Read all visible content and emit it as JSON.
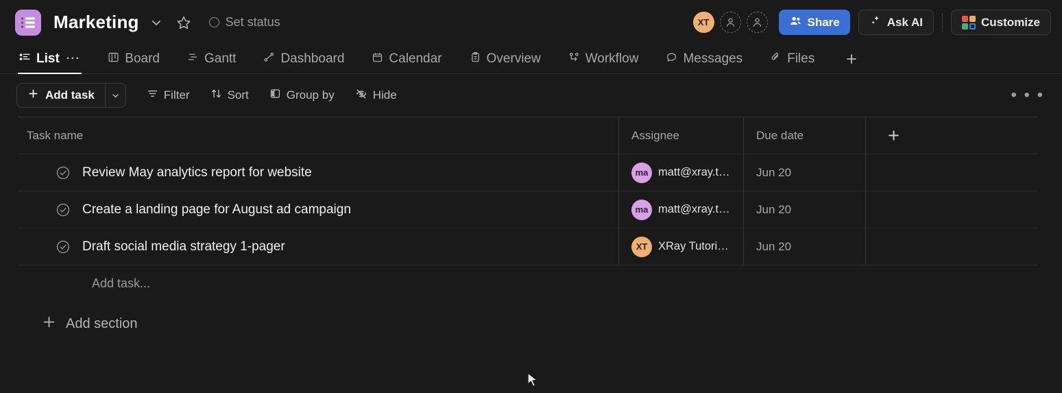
{
  "header": {
    "app_icon": "list-app-icon",
    "title": "Marketing",
    "title_chevron_icon": "chevron-down-icon",
    "favorite_icon": "star-icon",
    "set_status_label": "Set status",
    "status_icon": "circle-icon",
    "avatars": [
      {
        "initials": "XT",
        "color": "#f0b071",
        "name": "xray-tutorials-avatar"
      },
      {
        "initials": "",
        "color": "",
        "name": "invite-member-avatar-1"
      },
      {
        "initials": "",
        "color": "",
        "name": "invite-member-avatar-2"
      }
    ],
    "share_label": "Share",
    "share_icon": "people-icon",
    "share_color": "#3b6fd4",
    "ask_ai_label": "Ask AI",
    "ask_ai_icon": "sparkles-icon",
    "customize_label": "Customize",
    "customize_icon": "color-blocks-icon",
    "customize_colors": [
      "#e8584b",
      "#efae5a",
      "#4aa97a",
      "#3b82e0"
    ]
  },
  "tabs": {
    "items": [
      {
        "label": "List",
        "icon": "list-icon",
        "active": true,
        "has_dots": true
      },
      {
        "label": "Board",
        "icon": "board-icon",
        "active": false,
        "has_dots": false
      },
      {
        "label": "Gantt",
        "icon": "gantt-icon",
        "active": false,
        "has_dots": false
      },
      {
        "label": "Dashboard",
        "icon": "dashboard-icon",
        "active": false,
        "has_dots": false
      },
      {
        "label": "Calendar",
        "icon": "calendar-icon",
        "active": false,
        "has_dots": false
      },
      {
        "label": "Overview",
        "icon": "clipboard-icon",
        "active": false,
        "has_dots": false
      },
      {
        "label": "Workflow",
        "icon": "workflow-icon",
        "active": false,
        "has_dots": false
      },
      {
        "label": "Messages",
        "icon": "chat-icon",
        "active": false,
        "has_dots": false
      },
      {
        "label": "Files",
        "icon": "paperclip-icon",
        "active": false,
        "has_dots": false
      }
    ],
    "dots_label": "···",
    "add_view_icon": "plus-icon"
  },
  "toolbar": {
    "add_task_label": "Add task",
    "add_task_icon": "plus-icon",
    "add_task_caret_icon": "chevron-down-icon",
    "filter_label": "Filter",
    "filter_icon": "filter-icon",
    "sort_label": "Sort",
    "sort_icon": "sort-arrows-icon",
    "group_by_label": "Group by",
    "group_by_icon": "group-icon",
    "hide_label": "Hide",
    "hide_icon": "eye-off-icon",
    "overflow_label": "• • •"
  },
  "table": {
    "columns": [
      {
        "label": "Task name",
        "name": "column-task-name"
      },
      {
        "label": "Assignee",
        "name": "column-assignee"
      },
      {
        "label": "Due date",
        "name": "column-due-date"
      }
    ],
    "add_column_icon": "plus-icon",
    "rows": [
      {
        "check_icon": "check-circle-icon",
        "task": "Review May analytics report for website",
        "assignee_initials": "ma",
        "assignee_color": "#d9a0e8",
        "assignee_name": "matt@xray.t…",
        "due_date": "Jun 20"
      },
      {
        "check_icon": "check-circle-icon",
        "task": "Create a landing page for August ad campaign",
        "assignee_initials": "ma",
        "assignee_color": "#d9a0e8",
        "assignee_name": "matt@xray.t…",
        "due_date": "Jun 20"
      },
      {
        "check_icon": "check-circle-icon",
        "task": "Draft social media strategy 1-pager",
        "assignee_initials": "XT",
        "assignee_color": "#f0b071",
        "assignee_name": "XRay Tutori…",
        "due_date": "Jun 20"
      }
    ],
    "add_task_placeholder": "Add task..."
  },
  "footer": {
    "add_section_label": "Add section",
    "add_section_icon": "plus-icon"
  }
}
